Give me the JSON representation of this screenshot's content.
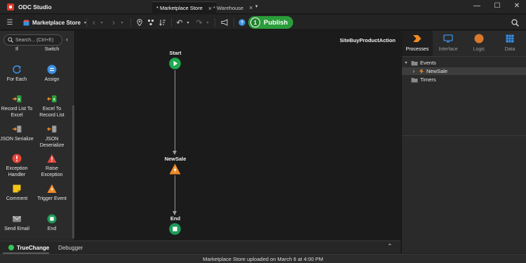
{
  "app": {
    "title": "ODC Studio"
  },
  "tabs": [
    {
      "label": "* Marketplace Store",
      "close": "×"
    },
    {
      "label": "* Warehouse",
      "close": "×"
    }
  ],
  "tab_dropdown": "▾",
  "window_controls": {
    "minimize": "—",
    "maximize": "☐",
    "close": "✕"
  },
  "toolbar": {
    "menu_icon": "☰",
    "app_selector": "Marketplace Store",
    "app_selector_chevron": "▾",
    "back": "‹",
    "back_menu": "▾",
    "forward": "›",
    "forward_menu": "▾",
    "undo": "↶",
    "undo_menu": "▾",
    "redo": "↷",
    "redo_menu": "▾",
    "publish_badge": "1",
    "publish_label": "Publish",
    "search_icon": "search-icon"
  },
  "toolbox": {
    "search_placeholder": "Search... (Ctrl+E)",
    "collapse": "‹",
    "partial_items": [
      "If",
      "Switch"
    ],
    "items": [
      {
        "label": "For Each",
        "icon": "for-each-icon"
      },
      {
        "label": "Assign",
        "icon": "assign-icon"
      },
      {
        "label": "Record List To Excel",
        "icon": "record-list-to-excel-icon"
      },
      {
        "label": "Excel To Record List",
        "icon": "excel-to-record-list-icon"
      },
      {
        "label": "JSON Serialize",
        "icon": "json-serialize-icon"
      },
      {
        "label": "JSON Deserialize",
        "icon": "json-deserialize-icon"
      },
      {
        "label": "Exception Handler",
        "icon": "exception-handler-icon"
      },
      {
        "label": "Raise Exception",
        "icon": "raise-exception-icon"
      },
      {
        "label": "Comment",
        "icon": "comment-icon"
      },
      {
        "label": "Trigger Event",
        "icon": "trigger-event-icon"
      },
      {
        "label": "Send Email",
        "icon": "send-email-icon"
      },
      {
        "label": "End",
        "icon": "end-icon"
      }
    ]
  },
  "canvas": {
    "title": "SiteBuyProductAction",
    "nodes": [
      {
        "label": "Start",
        "type": "start"
      },
      {
        "label": "NewSale",
        "type": "trigger-event"
      },
      {
        "label": "End",
        "type": "end"
      }
    ]
  },
  "bottom_panel": {
    "tabs": [
      {
        "label": "TrueChange",
        "active": true
      },
      {
        "label": "Debugger",
        "active": false
      }
    ],
    "expand": "⌃"
  },
  "right_panel": {
    "tabs": [
      {
        "label": "Processes",
        "active": true,
        "icon": "processes-icon"
      },
      {
        "label": "Interface",
        "active": false,
        "icon": "interface-icon"
      },
      {
        "label": "Logic",
        "active": false,
        "icon": "logic-icon"
      },
      {
        "label": "Data",
        "active": false,
        "icon": "data-icon"
      }
    ],
    "tree": [
      {
        "label": "Events",
        "expander": "▾",
        "icon": "folder-icon"
      },
      {
        "label": "NewSale",
        "expander": "›",
        "icon": "event-icon",
        "selected": true
      },
      {
        "label": "Timers",
        "expander": "",
        "icon": "folder-icon"
      }
    ]
  },
  "status": "Marketplace Store uploaded on March 6 at 4:00 PM",
  "colors": {
    "accent_green": "#2a9d3a",
    "start_green": "#1fa84f",
    "event_orange": "#f08a24",
    "end_green": "#1e9a58",
    "blue": "#3b8fe0"
  }
}
